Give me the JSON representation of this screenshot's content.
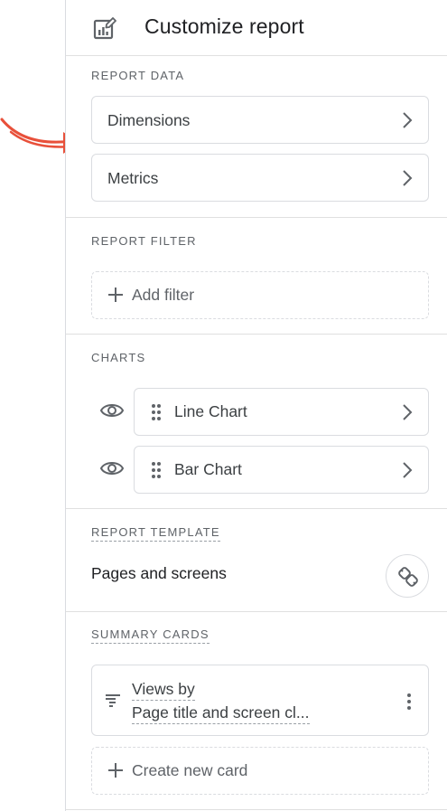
{
  "header": {
    "title": "Customize report"
  },
  "report_data": {
    "label": "REPORT DATA",
    "items": [
      {
        "label": "Dimensions"
      },
      {
        "label": "Metrics"
      }
    ]
  },
  "report_filter": {
    "label": "REPORT FILTER",
    "add_label": "Add filter"
  },
  "charts": {
    "label": "CHARTS",
    "items": [
      {
        "label": "Line Chart"
      },
      {
        "label": "Bar Chart"
      }
    ]
  },
  "report_template": {
    "label": "REPORT TEMPLATE",
    "value": "Pages and screens"
  },
  "summary_cards": {
    "label": "SUMMARY CARDS",
    "card": {
      "line1": "Views by",
      "line2": "Page title and screen cl..."
    },
    "create_label": "Create new card"
  },
  "colors": {
    "annotation_arrow": "#e8503a",
    "border": "#dadce0",
    "icon": "#5f6368"
  },
  "icons": {
    "header": "report-edit-icon",
    "chevron": "chevron-right-icon",
    "plus": "plus-icon",
    "eye": "eye-icon",
    "drag": "drag-handle-icon",
    "link": "link-icon",
    "card": "summary-card-icon",
    "more": "more-vert-icon"
  }
}
